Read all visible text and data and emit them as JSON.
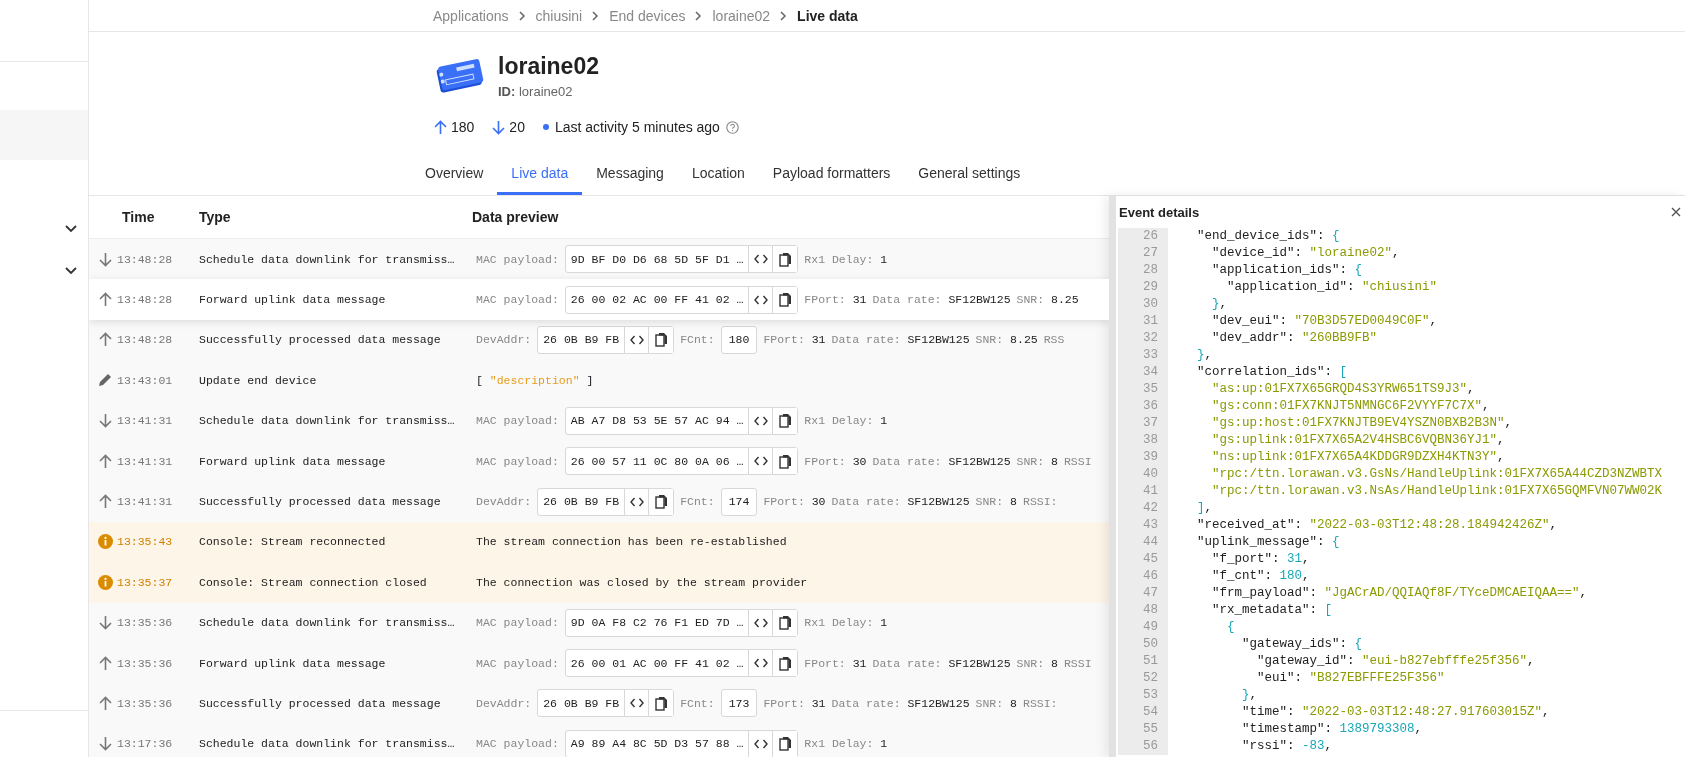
{
  "breadcrumbs": [
    "Applications",
    "chiusini",
    "End devices",
    "loraine02",
    "Live data"
  ],
  "device": {
    "name": "loraine02",
    "id_label": "ID:",
    "id": "loraine02"
  },
  "stats": {
    "uplinks": "180",
    "downlinks": "20",
    "activity": "Last activity 5 minutes ago"
  },
  "tabs": [
    {
      "label": "Overview",
      "selected": false
    },
    {
      "label": "Live data",
      "selected": true
    },
    {
      "label": "Messaging",
      "selected": false
    },
    {
      "label": "Location",
      "selected": false
    },
    {
      "label": "Payload formatters",
      "selected": false
    },
    {
      "label": "General settings",
      "selected": false
    }
  ],
  "table": {
    "columns": [
      "Time",
      "Type",
      "Data preview"
    ],
    "rows": [
      {
        "kind": "downlink",
        "selected": false,
        "time": "13:48:28",
        "type": "Schedule data downlink for transmiss…",
        "preview": [
          {
            "kind": "label",
            "text": "MAC payload:"
          },
          {
            "kind": "hex",
            "value": "9D BF D0 D6 68 5D 5F D1 …"
          },
          {
            "kind": "field",
            "label": "Rx1 Delay:",
            "value": "1"
          }
        ]
      },
      {
        "kind": "uplink",
        "selected": true,
        "time": "13:48:28",
        "type": "Forward uplink data message",
        "preview": [
          {
            "kind": "label",
            "text": "MAC payload:"
          },
          {
            "kind": "hex",
            "value": "26 00 02 AC 00 FF 41 02 …"
          },
          {
            "kind": "field",
            "label": "FPort:",
            "value": "31"
          },
          {
            "kind": "field",
            "label": "Data rate:",
            "value": "SF12BW125"
          },
          {
            "kind": "field",
            "label": "SNR:",
            "value": "8.25"
          }
        ]
      },
      {
        "kind": "uplink",
        "selected": false,
        "time": "13:48:28",
        "type": "Successfully processed data message",
        "preview": [
          {
            "kind": "label",
            "text": "DevAddr:"
          },
          {
            "kind": "hex",
            "value": "26 0B B9 FB"
          },
          {
            "kind": "label",
            "text": "FCnt:"
          },
          {
            "kind": "count",
            "value": "180"
          },
          {
            "kind": "field",
            "label": "FPort:",
            "value": "31"
          },
          {
            "kind": "field",
            "label": "Data rate:",
            "value": "SF12BW125"
          },
          {
            "kind": "field",
            "label": "SNR:",
            "value": "8.25"
          },
          {
            "kind": "label",
            "text": "RSS"
          }
        ]
      },
      {
        "kind": "update",
        "selected": false,
        "time": "13:43:01",
        "type": "Update end device",
        "preview": [
          {
            "kind": "json",
            "open": "[",
            "value": "\"description\"",
            "close": "]"
          }
        ]
      },
      {
        "kind": "downlink",
        "selected": false,
        "time": "13:41:31",
        "type": "Schedule data downlink for transmiss…",
        "preview": [
          {
            "kind": "label",
            "text": "MAC payload:"
          },
          {
            "kind": "hex",
            "value": "AB A7 D8 53 5E 57 AC 94 …"
          },
          {
            "kind": "field",
            "label": "Rx1 Delay:",
            "value": "1"
          }
        ]
      },
      {
        "kind": "uplink",
        "selected": false,
        "time": "13:41:31",
        "type": "Forward uplink data message",
        "preview": [
          {
            "kind": "label",
            "text": "MAC payload:"
          },
          {
            "kind": "hex",
            "value": "26 00 57 11 0C 80 0A 06 …"
          },
          {
            "kind": "field",
            "label": "FPort:",
            "value": "30"
          },
          {
            "kind": "field",
            "label": "Data rate:",
            "value": "SF12BW125"
          },
          {
            "kind": "field",
            "label": "SNR:",
            "value": "8"
          },
          {
            "kind": "label",
            "text": "RSSI"
          }
        ]
      },
      {
        "kind": "uplink",
        "selected": false,
        "time": "13:41:31",
        "type": "Successfully processed data message",
        "preview": [
          {
            "kind": "label",
            "text": "DevAddr:"
          },
          {
            "kind": "hex",
            "value": "26 0B B9 FB"
          },
          {
            "kind": "label",
            "text": "FCnt:"
          },
          {
            "kind": "count",
            "value": "174"
          },
          {
            "kind": "field",
            "label": "FPort:",
            "value": "30"
          },
          {
            "kind": "field",
            "label": "Data rate:",
            "value": "SF12BW125"
          },
          {
            "kind": "field",
            "label": "SNR:",
            "value": "8"
          },
          {
            "kind": "label",
            "text": "RSSI:"
          }
        ]
      },
      {
        "kind": "warning",
        "selected": false,
        "time": "13:35:43",
        "type": "Console: Stream reconnected",
        "preview": [
          {
            "kind": "message",
            "text": "The stream connection has been re-established"
          }
        ]
      },
      {
        "kind": "warning",
        "selected": false,
        "time": "13:35:37",
        "type": "Console: Stream connection closed",
        "preview": [
          {
            "kind": "message",
            "text": "The connection was closed by the stream provider"
          }
        ]
      },
      {
        "kind": "downlink",
        "selected": false,
        "time": "13:35:36",
        "type": "Schedule data downlink for transmiss…",
        "preview": [
          {
            "kind": "label",
            "text": "MAC payload:"
          },
          {
            "kind": "hex",
            "value": "9D 0A F8 C2 76 F1 ED 7D …"
          },
          {
            "kind": "field",
            "label": "Rx1 Delay:",
            "value": "1"
          }
        ]
      },
      {
        "kind": "uplink",
        "selected": false,
        "time": "13:35:36",
        "type": "Forward uplink data message",
        "preview": [
          {
            "kind": "label",
            "text": "MAC payload:"
          },
          {
            "kind": "hex",
            "value": "26 00 01 AC 00 FF 41 02 …"
          },
          {
            "kind": "field",
            "label": "FPort:",
            "value": "31"
          },
          {
            "kind": "field",
            "label": "Data rate:",
            "value": "SF12BW125"
          },
          {
            "kind": "field",
            "label": "SNR:",
            "value": "8"
          },
          {
            "kind": "label",
            "text": "RSSI"
          }
        ]
      },
      {
        "kind": "uplink",
        "selected": false,
        "time": "13:35:36",
        "type": "Successfully processed data message",
        "preview": [
          {
            "kind": "label",
            "text": "DevAddr:"
          },
          {
            "kind": "hex",
            "value": "26 0B B9 FB"
          },
          {
            "kind": "label",
            "text": "FCnt:"
          },
          {
            "kind": "count",
            "value": "173"
          },
          {
            "kind": "field",
            "label": "FPort:",
            "value": "31"
          },
          {
            "kind": "field",
            "label": "Data rate:",
            "value": "SF12BW125"
          },
          {
            "kind": "field",
            "label": "SNR:",
            "value": "8"
          },
          {
            "kind": "label",
            "text": "RSSI:"
          }
        ]
      },
      {
        "kind": "downlink",
        "selected": false,
        "time": "13:17:36",
        "type": "Schedule data downlink for transmiss…",
        "preview": [
          {
            "kind": "label",
            "text": "MAC payload:"
          },
          {
            "kind": "hex",
            "value": "A9 89 A4 8C 5D D3 57 88 …"
          },
          {
            "kind": "field",
            "label": "Rx1 Delay:",
            "value": "1"
          }
        ]
      }
    ]
  },
  "event_details": {
    "title": "Event details",
    "lines": [
      {
        "number": "26",
        "code": "  \"end_device_ids\": {"
      },
      {
        "number": "27",
        "code": "    \"device_id\": \"loraine02\","
      },
      {
        "number": "28",
        "code": "    \"application_ids\": {"
      },
      {
        "number": "29",
        "code": "      \"application_id\": \"chiusini\""
      },
      {
        "number": "30",
        "code": "    },"
      },
      {
        "number": "31",
        "code": "    \"dev_eui\": \"70B3D57ED0049C0F\","
      },
      {
        "number": "32",
        "code": "    \"dev_addr\": \"260BB9FB\""
      },
      {
        "number": "33",
        "code": "  },"
      },
      {
        "number": "34",
        "code": "  \"correlation_ids\": ["
      },
      {
        "number": "35",
        "code": "    \"as:up:01FX7X65GRQD4S3YRW651TS9J3\","
      },
      {
        "number": "36",
        "code": "    \"gs:conn:01FX7KNJT5NMNGC6F2VYYF7C7X\","
      },
      {
        "number": "37",
        "code": "    \"gs:up:host:01FX7KNJTB9EV4YSZN0BXB2B3N\","
      },
      {
        "number": "38",
        "code": "    \"gs:uplink:01FX7X65A2V4HSBC6VQBN36YJ1\","
      },
      {
        "number": "39",
        "code": "    \"ns:uplink:01FX7X65A4KDDGR9DZXH4KTN3Y\","
      },
      {
        "number": "40",
        "code": "    \"rpc:/ttn.lorawan.v3.GsNs/HandleUplink:01FX7X65A44CZD3NZWBTX"
      },
      {
        "number": "41",
        "code": "    \"rpc:/ttn.lorawan.v3.NsAs/HandleUplink:01FX7X65GQMFVN07WW02K"
      },
      {
        "number": "42",
        "code": "  ],"
      },
      {
        "number": "43",
        "code": "  \"received_at\": \"2022-03-03T12:48:28.184942426Z\","
      },
      {
        "number": "44",
        "code": "  \"uplink_message\": {"
      },
      {
        "number": "45",
        "code": "    \"f_port\": 31,"
      },
      {
        "number": "46",
        "code": "    \"f_cnt\": 180,"
      },
      {
        "number": "47",
        "code": "    \"frm_payload\": \"JgACrAD/QQIAQf8F/TYceDMCAEIQAA==\","
      },
      {
        "number": "48",
        "code": "    \"rx_metadata\": ["
      },
      {
        "number": "49",
        "code": "      {"
      },
      {
        "number": "50",
        "code": "        \"gateway_ids\": {"
      },
      {
        "number": "51",
        "code": "          \"gateway_id\": \"eui-b827ebfffe25f356\","
      },
      {
        "number": "52",
        "code": "          \"eui\": \"B827EBFFFE25F356\""
      },
      {
        "number": "53",
        "code": "        },"
      },
      {
        "number": "54",
        "code": "        \"time\": \"2022-03-03T12:48:27.917603015Z\","
      },
      {
        "number": "55",
        "code": "        \"timestamp\": 1389793308,"
      },
      {
        "number": "56",
        "code": "        \"rssi\": -83,"
      }
    ]
  }
}
